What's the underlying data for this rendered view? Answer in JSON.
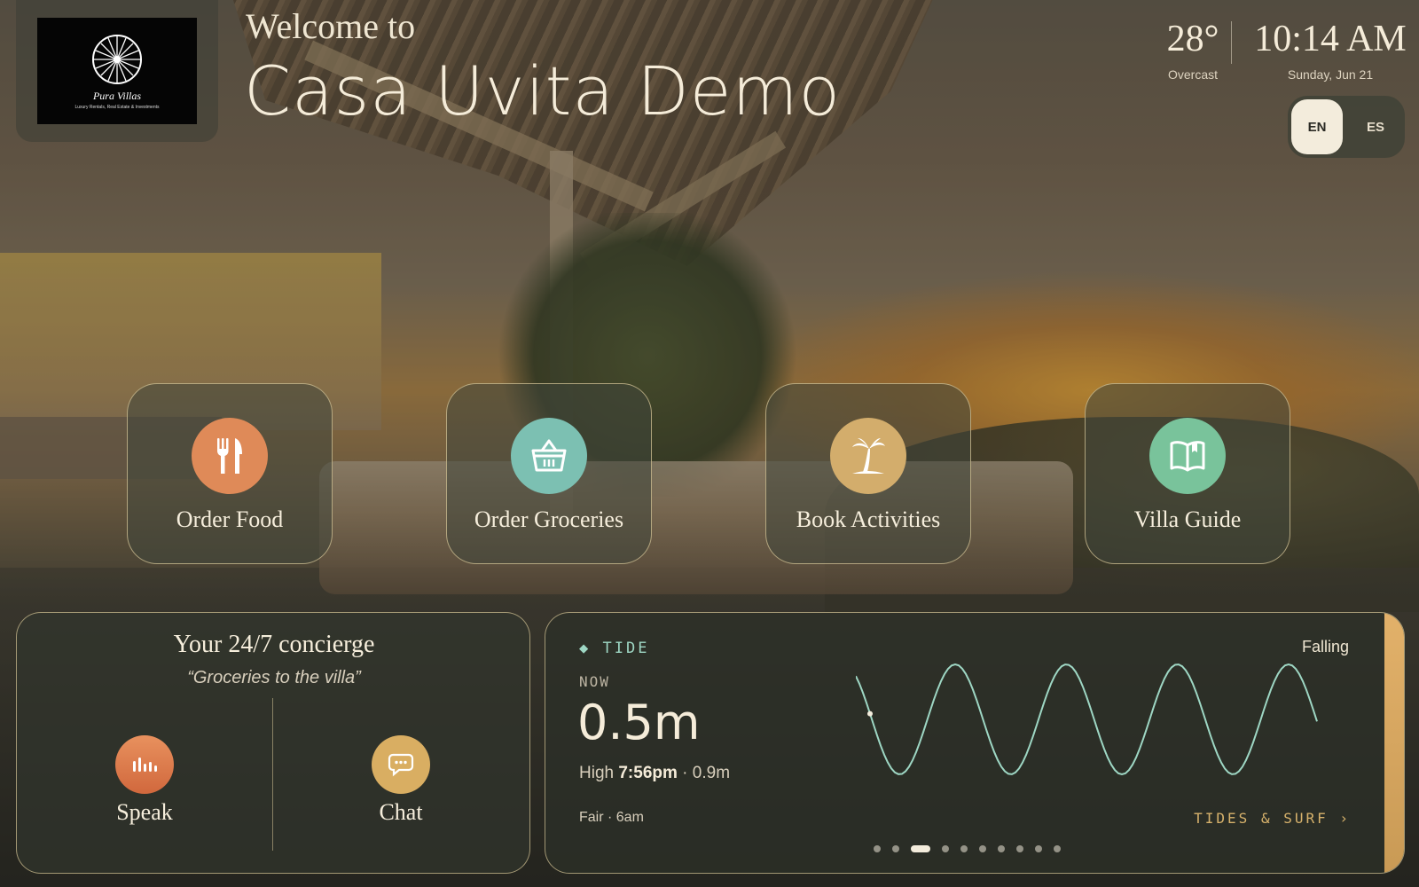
{
  "brand": {
    "logo_name": "Pura Villas",
    "logo_tagline": "Luxury Rentals, Real Estate & Investments"
  },
  "header": {
    "welcome": "Welcome to",
    "villa_name": "Casa Uvita Demo"
  },
  "weather": {
    "temperature": "28°",
    "condition": "Overcast"
  },
  "clock": {
    "time": "10:14 AM",
    "date": "Sunday, Jun 21"
  },
  "language": {
    "selected": "EN",
    "options": [
      "EN",
      "ES"
    ]
  },
  "actions": [
    {
      "label": "Order Food",
      "icon": "fork-knife-icon",
      "color": "#df8a58"
    },
    {
      "label": "Order Groceries",
      "icon": "basket-icon",
      "color": "#7cc0b2"
    },
    {
      "label": "Book Activities",
      "icon": "palm-tree-icon",
      "color": "#d3ad6c"
    },
    {
      "label": "Villa Guide",
      "icon": "book-icon",
      "color": "#79c39b"
    }
  ],
  "concierge": {
    "title": "Your 24/7 concierge",
    "quote": "“Groceries to the villa”",
    "speak_label": "Speak",
    "chat_label": "Chat",
    "speak_color": "#e07e4e",
    "chat_color": "#d9ae62"
  },
  "tide": {
    "heading": "TIDE",
    "state": "Falling",
    "now_label": "NOW",
    "current": "0.5m",
    "next_high_prefix": "High",
    "next_high_time": "7:56pm",
    "next_high_suffix": "· 0.9m",
    "conditions": "Fair · 6am",
    "link": "TIDES & SURF ›",
    "pages_total": 10,
    "page_active": 3,
    "accent_color": "#9ed7c4"
  }
}
